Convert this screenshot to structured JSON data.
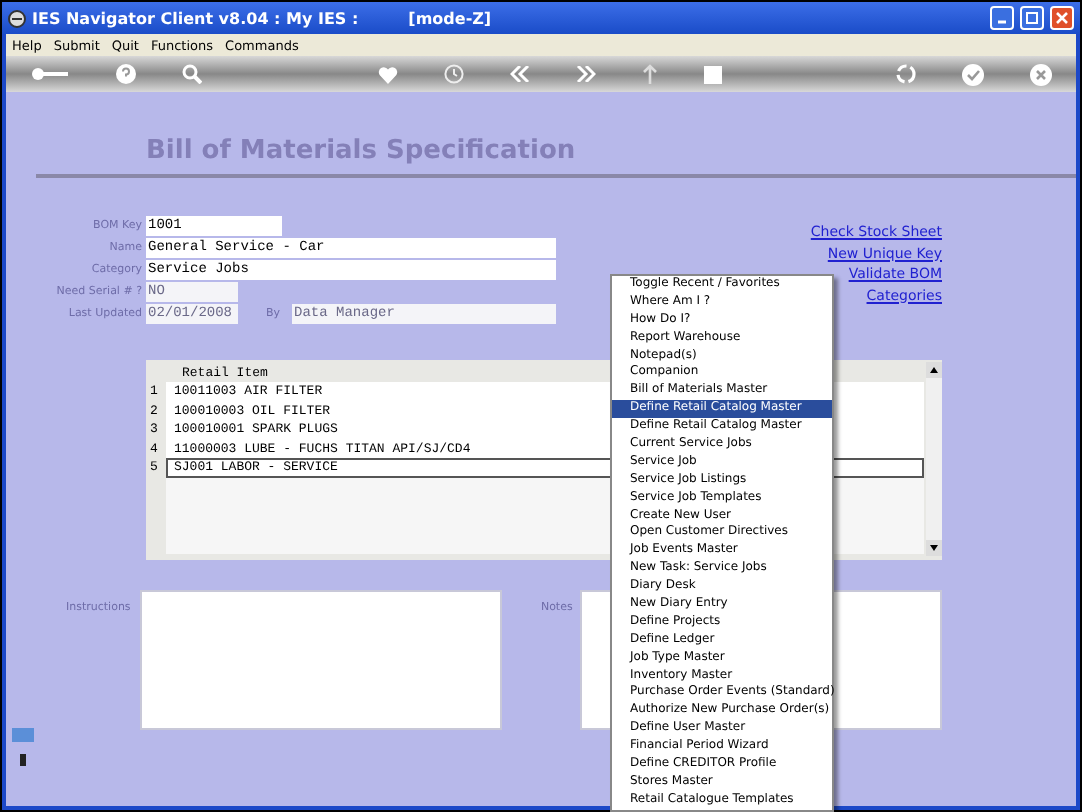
{
  "window": {
    "title": "IES Navigator Client v8.04 : My IES :",
    "mode": "[mode-Z]"
  },
  "menu_bar": [
    "Help",
    "Submit",
    "Quit",
    "Functions",
    "Commands"
  ],
  "form": {
    "title": "Bill of Materials Specification",
    "fields": [
      {
        "label": "BOM Key",
        "value": "1001",
        "disabled": false
      },
      {
        "label": "Name",
        "value": "General Service - Car",
        "disabled": false
      },
      {
        "label": "Category",
        "value": "Service Jobs",
        "disabled": false
      },
      {
        "label": "Need Serial # ?",
        "value": "NO",
        "disabled": true
      },
      {
        "label": "Last Updated",
        "value": "02/01/2008",
        "disabled": true
      }
    ],
    "by": {
      "label": "By",
      "value": "Data Manager",
      "disabled": true
    }
  },
  "links": [
    "Check Stock Sheet",
    "New Unique Key",
    "Validate BOM",
    "Categories"
  ],
  "items_table": {
    "header": "Retail Item",
    "rows": [
      {
        "number": "1",
        "text": "10011003 AIR FILTER",
        "selected": false
      },
      {
        "number": "2",
        "text": "100010003 OIL FILTER",
        "selected": false
      },
      {
        "number": "3",
        "text": "100010001 SPARK PLUGS",
        "selected": false
      },
      {
        "number": "4",
        "text": "11000003 LUBE - FUCHS TITAN API/SJ/CD4",
        "selected": false
      },
      {
        "number": "5",
        "text": "SJ001 LABOR - SERVICE",
        "selected": true
      }
    ]
  },
  "instructions": {
    "label": "Instructions"
  },
  "notes": {
    "label": "Notes"
  },
  "context_menu": {
    "items": [
      {
        "label": "Toggle Recent / Favorites",
        "selected": false
      },
      {
        "label": "Where Am I ?",
        "selected": false
      },
      {
        "label": "How Do I?",
        "selected": false
      },
      {
        "label": "Report Warehouse",
        "selected": false
      },
      {
        "label": "Notepad(s)",
        "selected": false
      },
      {
        "label": "Companion",
        "selected": false
      },
      {
        "label": "Bill of Materials Master",
        "selected": false
      },
      {
        "label": "Define Retail Catalog Master",
        "selected": true
      },
      {
        "label": "Define Retail Catalog Master",
        "selected": false
      },
      {
        "label": "Current Service Jobs",
        "selected": false
      },
      {
        "label": "Service Job",
        "selected": false
      },
      {
        "label": "Service Job Listings",
        "selected": false
      },
      {
        "label": "Service Job Templates",
        "selected": false
      },
      {
        "label": "Create New User",
        "selected": false
      },
      {
        "label": "Open Customer Directives",
        "selected": false
      },
      {
        "label": "Job Events Master",
        "selected": false
      },
      {
        "label": "New Task: Service Jobs",
        "selected": false
      },
      {
        "label": "Diary Desk",
        "selected": false
      },
      {
        "label": "New Diary Entry",
        "selected": false
      },
      {
        "label": "Define Projects",
        "selected": false
      },
      {
        "label": "Define Ledger",
        "selected": false
      },
      {
        "label": "Job Type Master",
        "selected": false
      },
      {
        "label": "Inventory Master",
        "selected": false
      },
      {
        "label": "Purchase Order Events (Standard)",
        "selected": false
      },
      {
        "label": "Authorize New Purchase Order(s)",
        "selected": false
      },
      {
        "label": "Define User Master",
        "selected": false
      },
      {
        "label": "Financial Period Wizard",
        "selected": false
      },
      {
        "label": "Define CREDITOR Profile",
        "selected": false
      },
      {
        "label": "Stores Master",
        "selected": false
      },
      {
        "label": "Retail Catalogue Templates",
        "selected": false
      }
    ]
  }
}
